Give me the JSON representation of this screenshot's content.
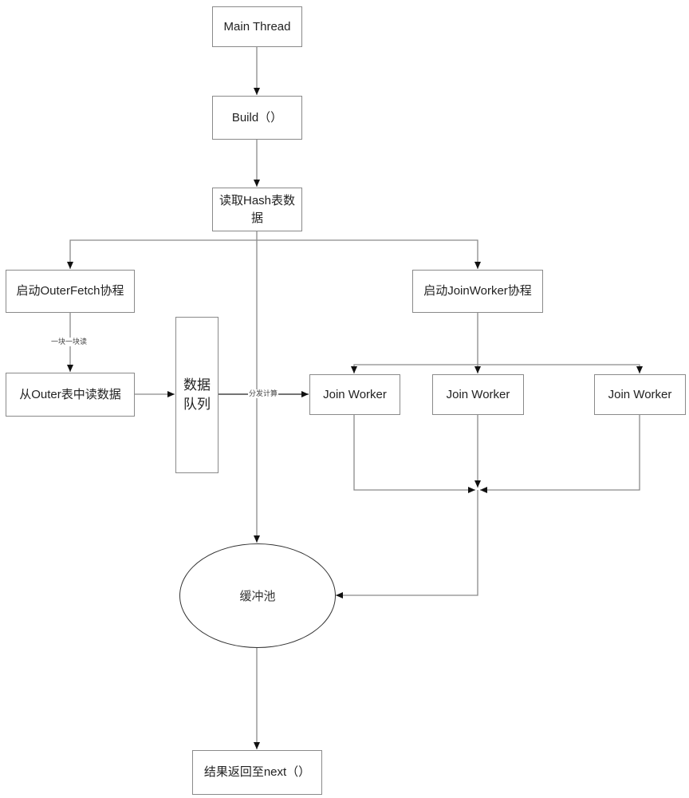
{
  "diagram": {
    "type": "flowchart",
    "nodes": {
      "main_thread": "Main Thread",
      "build": "Build（）",
      "read_hash": "读取Hash表数据",
      "start_outer_fetch": "启动OuterFetch协程",
      "start_join_worker": "启动JoinWorker协程",
      "read_outer": "从Outer表中读数据",
      "data_queue": "数据队列",
      "join_worker_1": "Join Worker",
      "join_worker_2": "Join Worker",
      "join_worker_3": "Join Worker",
      "buffer_pool": "缓冲池",
      "return_result": "结果返回至next（）"
    },
    "edge_labels": {
      "block_read": "一块一块读",
      "dispatch_compute": "分发计算"
    },
    "edges": [
      {
        "from": "main_thread",
        "to": "build"
      },
      {
        "from": "build",
        "to": "read_hash"
      },
      {
        "from": "read_hash",
        "to": "start_outer_fetch"
      },
      {
        "from": "read_hash",
        "to": "start_join_worker"
      },
      {
        "from": "read_hash",
        "to": "buffer_pool"
      },
      {
        "from": "start_outer_fetch",
        "to": "read_outer",
        "label": "一块一块读"
      },
      {
        "from": "read_outer",
        "to": "data_queue"
      },
      {
        "from": "data_queue",
        "to": "join_worker_1",
        "label": "分发计算"
      },
      {
        "from": "start_join_worker",
        "to": "join_worker_1"
      },
      {
        "from": "start_join_worker",
        "to": "join_worker_2"
      },
      {
        "from": "start_join_worker",
        "to": "join_worker_3"
      },
      {
        "from": "join_worker_1",
        "to": "buffer_pool"
      },
      {
        "from": "join_worker_2",
        "to": "buffer_pool"
      },
      {
        "from": "join_worker_3",
        "to": "buffer_pool"
      },
      {
        "from": "buffer_pool",
        "to": "return_result"
      }
    ]
  }
}
